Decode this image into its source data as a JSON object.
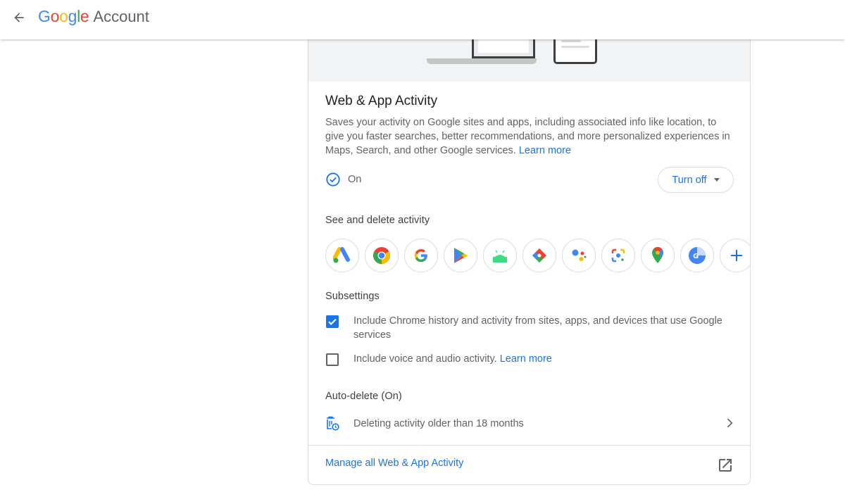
{
  "header": {
    "logo_text": "Google",
    "product_label": "Account"
  },
  "activity": {
    "title": "Web & App Activity",
    "description": "Saves your activity on Google sites and apps, including associated info like location, to give you faster searches, better recommendations, and more personalized experiences in Maps, Search, and other Google services.",
    "learn_more": "Learn more",
    "status": "On",
    "turn_off_label": "Turn off",
    "see_delete_heading": "See and delete activity",
    "apps": [
      "google-ads-icon",
      "chrome-icon",
      "google-search-icon",
      "google-play-icon",
      "android-icon",
      "google-shopping-icon",
      "google-assistant-icon",
      "google-lens-icon",
      "google-maps-icon",
      "google-translate-icon",
      "add-icon"
    ],
    "subsettings_heading": "Subsettings",
    "subsettings": [
      {
        "label": "Include Chrome history and activity from sites, apps, and devices that use Google services",
        "checked": true
      },
      {
        "label": "Include voice and audio activity.",
        "link": "Learn more",
        "checked": false
      }
    ],
    "autodelete_heading": "Auto-delete (On)",
    "autodelete_text": "Deleting activity older than 18 months",
    "manage_link": "Manage all Web & App Activity"
  },
  "colors": {
    "accent": "#1a73e8",
    "text_secondary": "#5f6368",
    "border": "#dadce0"
  }
}
